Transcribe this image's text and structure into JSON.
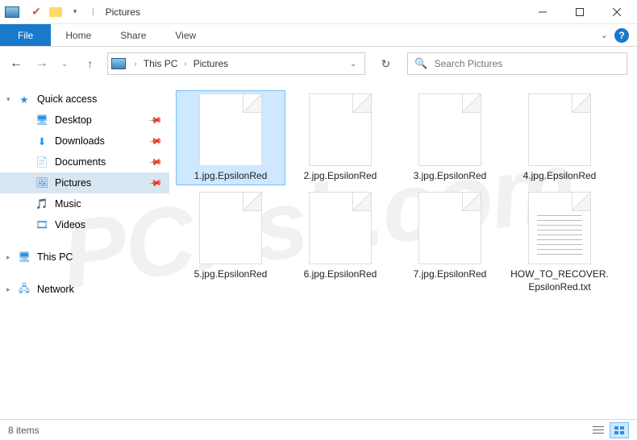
{
  "window": {
    "title": "Pictures"
  },
  "ribbon": {
    "file": "File",
    "tabs": [
      "Home",
      "Share",
      "View"
    ]
  },
  "breadcrumb": {
    "segments": [
      "This PC",
      "Pictures"
    ]
  },
  "search": {
    "placeholder": "Search Pictures"
  },
  "sidebar": {
    "quick_access": {
      "label": "Quick access",
      "items": [
        {
          "label": "Desktop",
          "pinned": true,
          "icon": "desktop"
        },
        {
          "label": "Downloads",
          "pinned": true,
          "icon": "downloads"
        },
        {
          "label": "Documents",
          "pinned": true,
          "icon": "documents"
        },
        {
          "label": "Pictures",
          "pinned": true,
          "icon": "pictures",
          "selected": true
        },
        {
          "label": "Music",
          "pinned": false,
          "icon": "music"
        },
        {
          "label": "Videos",
          "pinned": false,
          "icon": "videos"
        }
      ]
    },
    "this_pc": {
      "label": "This PC"
    },
    "network": {
      "label": "Network"
    }
  },
  "files": [
    {
      "name": "1.jpg.EpsilonRed",
      "type": "file",
      "selected": true
    },
    {
      "name": "2.jpg.EpsilonRed",
      "type": "file"
    },
    {
      "name": "3.jpg.EpsilonRed",
      "type": "file"
    },
    {
      "name": "4.jpg.EpsilonRed",
      "type": "file"
    },
    {
      "name": "5.jpg.EpsilonRed",
      "type": "file"
    },
    {
      "name": "6.jpg.EpsilonRed",
      "type": "file"
    },
    {
      "name": "7.jpg.EpsilonRed",
      "type": "file"
    },
    {
      "name": "HOW_TO_RECOVER.EpsilonRed.txt",
      "type": "txt"
    }
  ],
  "statusbar": {
    "count_label": "8 items"
  },
  "watermark": "PCrisk.com"
}
